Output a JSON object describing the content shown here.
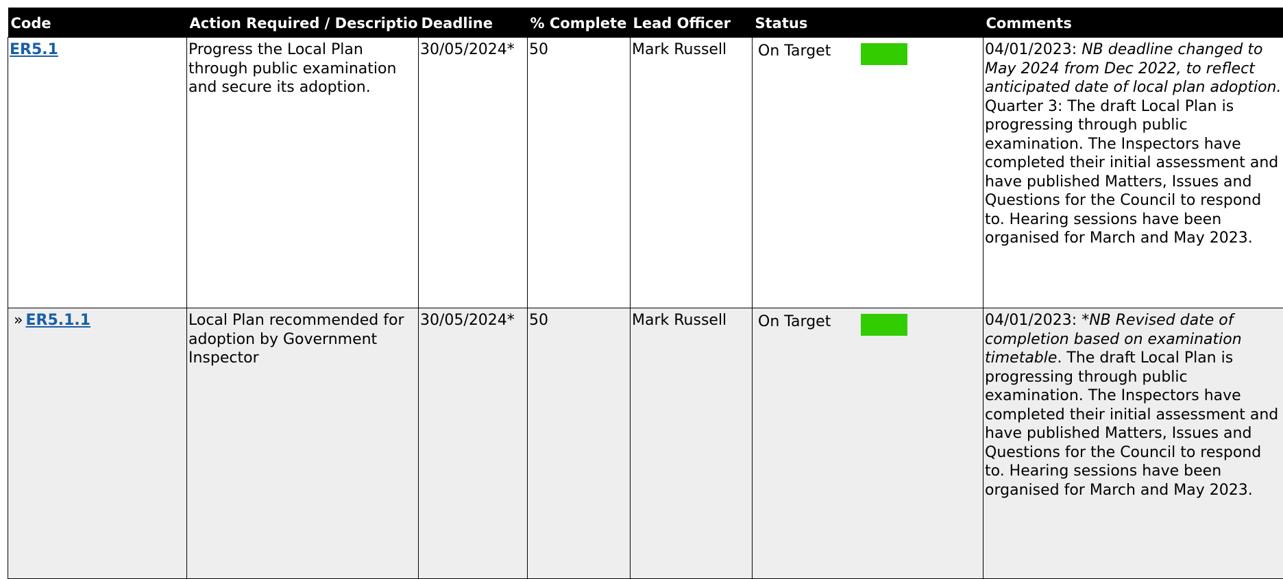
{
  "columns": {
    "code": "Code",
    "action": "Action Required / Description",
    "deadline": "Deadline",
    "complete": "% Complete",
    "lead": "Lead Officer",
    "status": "Status",
    "comments": "Comments"
  },
  "colors": {
    "on_target": "#33cc00",
    "header_bg": "#000000",
    "alt_row_bg": "#eeeeee",
    "link": "#1a5fa8"
  },
  "rows": [
    {
      "prefix": "",
      "code": "ER5.1",
      "action": "Progress the Local Plan through public examination and secure its adoption.",
      "deadline": "30/05/2024*",
      "complete": "50",
      "lead": "Mark Russell",
      "status": "On Target",
      "comment_date": "04/01/2023: ",
      "comment_italic": "NB deadline changed to May 2024 from Dec 2022, to reflect anticipated date of local plan adoption.",
      "comment_text": " Quarter 3: The draft Local Plan is progressing through public examination. The Inspectors have completed their initial assessment and have published Matters, Issues and Questions for the Council to respond to. Hearing sessions have been organised for March and May 2023."
    },
    {
      "prefix": "»",
      "code": "ER5.1.1",
      "action": "Local Plan recommended for adoption by Government Inspector",
      "deadline": "30/05/2024*",
      "complete": "50",
      "lead": "Mark Russell",
      "status": "On Target",
      "comment_date": "04/01/2023: *",
      "comment_italic": "NB Revised date of completion based on examination timetable",
      "comment_text": ". The draft Local Plan is progressing through public examination. The Inspectors have completed their initial assessment and have published Matters, Issues and Questions for the Council to respond to. Hearing sessions have been organised for March and May 2023."
    }
  ]
}
